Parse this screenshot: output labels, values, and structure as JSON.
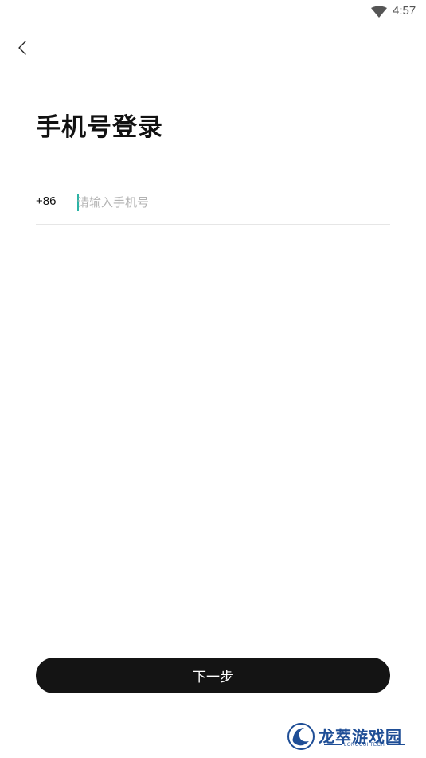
{
  "status_bar": {
    "time": "4:57",
    "wifi_icon": "wifi-icon"
  },
  "nav": {
    "back_icon": "chevron-left-icon"
  },
  "title": "手机号登录",
  "phone": {
    "country_code": "+86",
    "placeholder": "请输入手机号",
    "value": ""
  },
  "next_button_label": "下一步",
  "watermark": {
    "name": "龙萃游戏园",
    "sub": "LONGCUI TECH",
    "brand_color": "#1f4e96"
  },
  "colors": {
    "caret": "#2bb3a5",
    "button_bg": "#141414",
    "placeholder": "#b3b3b3"
  }
}
